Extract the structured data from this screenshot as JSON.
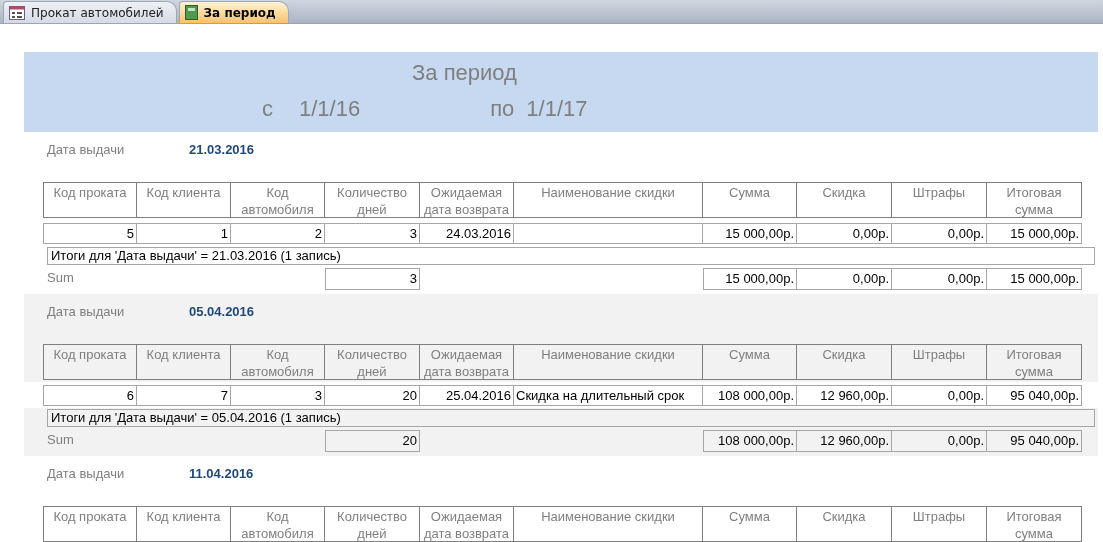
{
  "tabs": [
    {
      "label": "Прокат автомобилей",
      "selected": false,
      "kind": "form"
    },
    {
      "label": "За период",
      "selected": true,
      "kind": "report"
    }
  ],
  "report_header": {
    "title": "За период",
    "from_label": "с",
    "from_value": "1/1/16",
    "to_label": "по",
    "to_value": "1/1/17"
  },
  "groups": [
    {
      "color": "#ffffff",
      "field_label": "Дата выдачи",
      "field_value": "21.03.2016",
      "columns": [
        "Код проката",
        "Код клиента",
        "Код автомобиля",
        "Количество дней",
        "Ожидаемая дата возврата",
        "Наименование скидки",
        "Сумма",
        "Скидка",
        "Штрафы",
        "Итоговая сумма"
      ],
      "rows": [
        {
          "rental_id": "5",
          "client_id": "1",
          "car_id": "2",
          "days": "3",
          "return_date": "24.03.2016",
          "amount": "15 000,00р.",
          "discount": "0,00р.",
          "fines": "0,00р.",
          "total": "15 000,00р."
        }
      ],
      "summary_text": "Итоги для 'Дата выдачи' =  21.03.2016 (1 запись)",
      "sum_row": {
        "label": "Sum",
        "days": "3",
        "amount": "15 000,00р.",
        "discount": "0,00р.",
        "fines": "0,00р.",
        "total": "15 000,00р."
      }
    },
    {
      "color": "#f2f2f2",
      "field_label": "Дата выдачи",
      "field_value": "05.04.2016",
      "columns": [
        "Код проката",
        "Код клиента",
        "Код автомобиля",
        "Количество дней",
        "Ожидаемая дата возврата",
        "Наименование скидки",
        "Сумма",
        "Скидка",
        "Штрафы",
        "Итоговая сумма"
      ],
      "rows": [
        {
          "rental_id": "6",
          "client_id": "7",
          "car_id": "3",
          "days": "20",
          "return_date": "25.04.2016",
          "discount_name": "Скидка на длительный срок",
          "amount": "108 000,00р.",
          "discount": "12 960,00р.",
          "fines": "0,00р.",
          "total": "95 040,00р."
        }
      ],
      "summary_text": "Итоги для 'Дата выдачи' =  05.04.2016 (1 запись)",
      "sum_row": {
        "label": "Sum",
        "days": "20",
        "amount": "108 000,00р.",
        "discount": "12 960,00р.",
        "fines": "0,00р.",
        "total": "95 040,00р."
      }
    },
    {
      "color": "#ffffff",
      "field_label": "Дата выдачи",
      "field_value": "11.04.2016",
      "columns": [
        "Код проката",
        "Код клиента",
        "Код автомобиля",
        "Количество дней",
        "Ожидаемая дата возврата",
        "Наименование скидки",
        "Сумма",
        "Скидка",
        "Штрафы",
        "Итоговая сумма"
      ]
    }
  ]
}
